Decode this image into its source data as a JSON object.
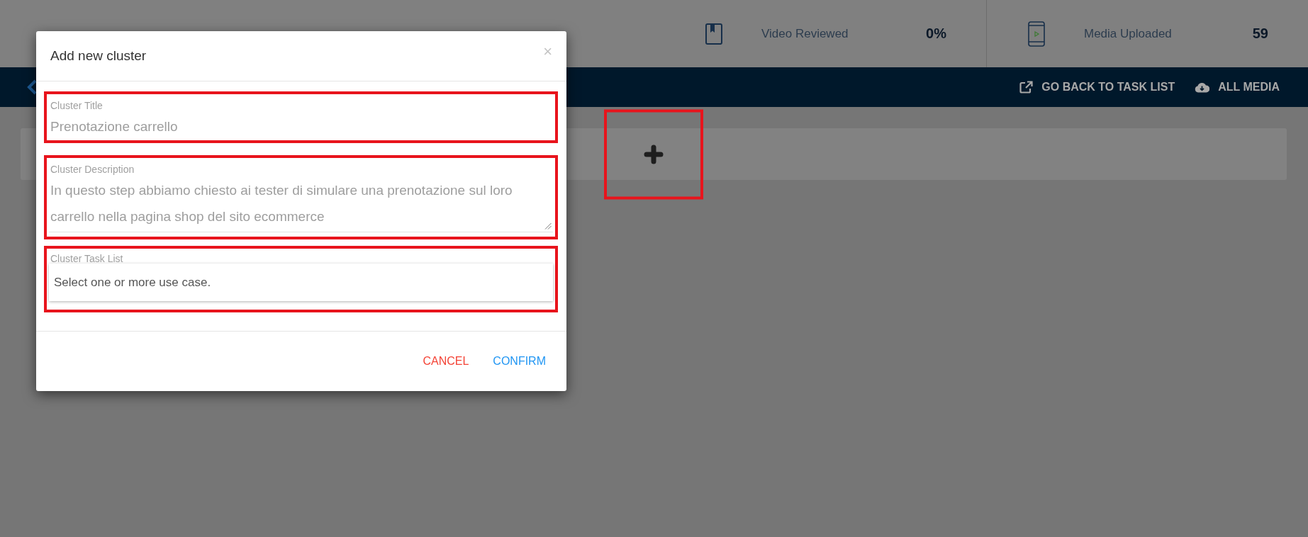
{
  "page": {
    "stats": [
      {
        "kind": "video",
        "label": "Video Reviewed",
        "value": "0%"
      },
      {
        "kind": "media",
        "label": "Media Uploaded",
        "value": "59"
      }
    ]
  },
  "nav": {
    "actions": [
      {
        "kind": "external",
        "label": "GO BACK TO TASK LIST"
      },
      {
        "kind": "download",
        "label": "ALL MEDIA"
      }
    ]
  },
  "content": {
    "add_button": {
      "highlighted": true
    }
  },
  "modal": {
    "title": "Add new cluster",
    "close": "×",
    "fields": [
      {
        "kind": "text",
        "label": "Cluster Title",
        "value": "Prenotazione carrello",
        "highlighted": true
      },
      {
        "kind": "textarea",
        "label": "Cluster Description",
        "value": "In questo step abbiamo chiesto ai tester di simulare una prenotazione sul loro carrello nella pagina shop del sito ecommerce",
        "highlighted": true
      },
      {
        "kind": "select",
        "label": "Cluster Task List",
        "placeholder": "Select one or more use case.",
        "highlighted": true
      }
    ],
    "buttons": [
      {
        "kind": "cancel",
        "label": "CANCEL"
      },
      {
        "kind": "confirm",
        "label": "CONFIRM"
      }
    ]
  }
}
